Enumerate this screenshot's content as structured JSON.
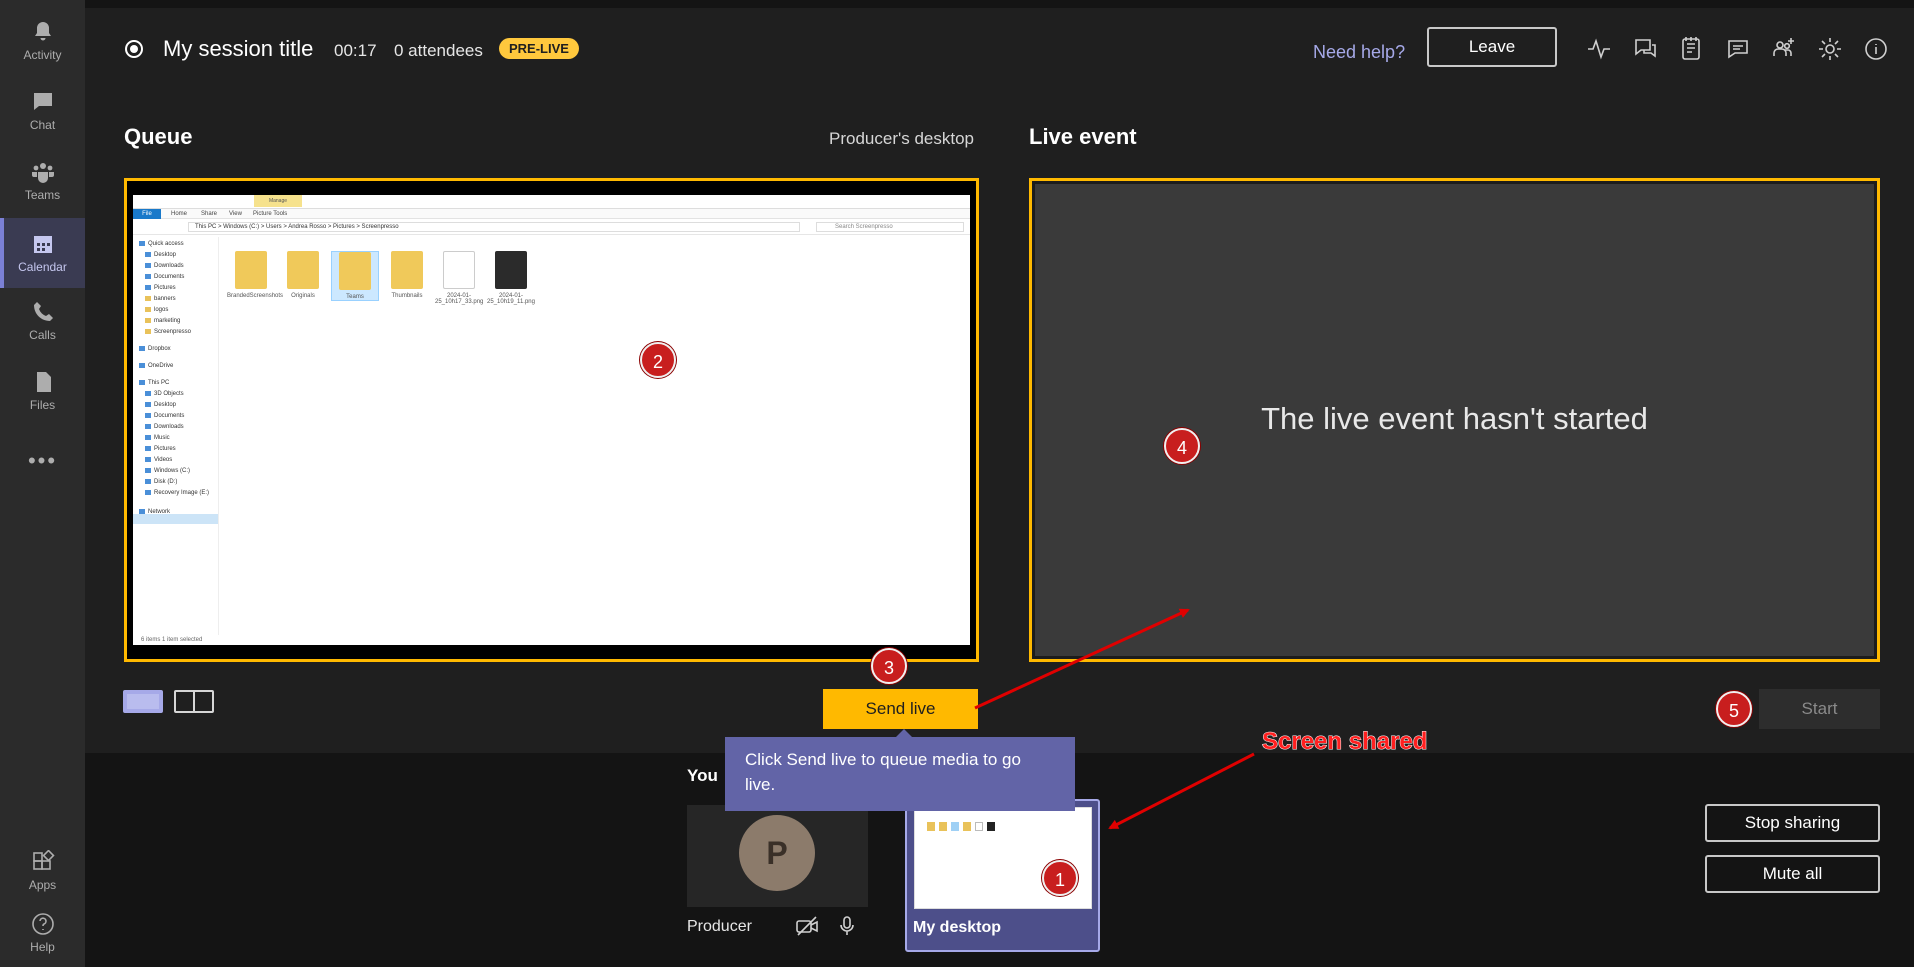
{
  "rail": {
    "items": [
      {
        "label": "Activity",
        "icon": "bell-icon"
      },
      {
        "label": "Chat",
        "icon": "chat-icon"
      },
      {
        "label": "Teams",
        "icon": "teams-icon"
      },
      {
        "label": "Calendar",
        "icon": "calendar-icon",
        "active": true
      },
      {
        "label": "Calls",
        "icon": "phone-icon"
      },
      {
        "label": "Files",
        "icon": "file-icon"
      }
    ],
    "more": "•••",
    "bottom_items": [
      {
        "label": "Apps",
        "icon": "apps-icon"
      },
      {
        "label": "Help",
        "icon": "help-icon"
      }
    ]
  },
  "header": {
    "session_title": "My session title",
    "timer": "00:17",
    "attendees": "0 attendees",
    "status_badge": "PRE-LIVE",
    "need_help": "Need help?",
    "leave": "Leave",
    "icons": [
      "health-icon",
      "qna-icon",
      "notes-icon",
      "chat-icon",
      "add-people-icon",
      "settings-icon",
      "info-icon"
    ]
  },
  "queue": {
    "title": "Queue",
    "source": "Producer's desktop",
    "explorer": {
      "ribbon_tab_highlight": "Manage",
      "ribbon": [
        "File",
        "Home",
        "Share",
        "View",
        "Picture Tools"
      ],
      "address": "This PC  >  Windows (C:)  >  Users  >  Andrea Rosso  >  Pictures  >  Screenpresso",
      "search_placeholder": "Search Screenpresso",
      "nav": [
        "Quick access",
        "Desktop",
        "Downloads",
        "Documents",
        "Pictures",
        "banners",
        "logos",
        "marketing",
        "Screenpresso",
        "Dropbox",
        "OneDrive",
        "This PC",
        "3D Objects",
        "Desktop",
        "Documents",
        "Downloads",
        "Music",
        "Pictures",
        "Videos",
        "Windows (C:)",
        "Disk (D:)",
        "Recovery Image (E:)",
        "Network"
      ],
      "files": [
        "BrandedScreenshots",
        "Originals",
        "Teams",
        "Thumbnails",
        "2024-01-25_10h17_33.png",
        "2024-01-25_10h19_11.png"
      ],
      "status": "6 items    1 item selected"
    }
  },
  "live": {
    "title": "Live event",
    "message": "The live event hasn't started"
  },
  "controls": {
    "send_live": "Send live",
    "start": "Start",
    "tooltip": "Click Send live to queue media to go live."
  },
  "participants": {
    "you_label": "You",
    "producer": {
      "name": "Producer",
      "initial": "P"
    },
    "desktop": {
      "name": "My desktop"
    },
    "stop_sharing": "Stop sharing",
    "mute_all": "Mute all"
  },
  "annotations": {
    "badges": [
      "1",
      "2",
      "3",
      "4",
      "5"
    ],
    "screen_shared": "Screen shared",
    "color": "#e00000"
  },
  "colors": {
    "accent": "#ffb900",
    "brand": "#6264a7",
    "background": "#1f1f1f"
  }
}
